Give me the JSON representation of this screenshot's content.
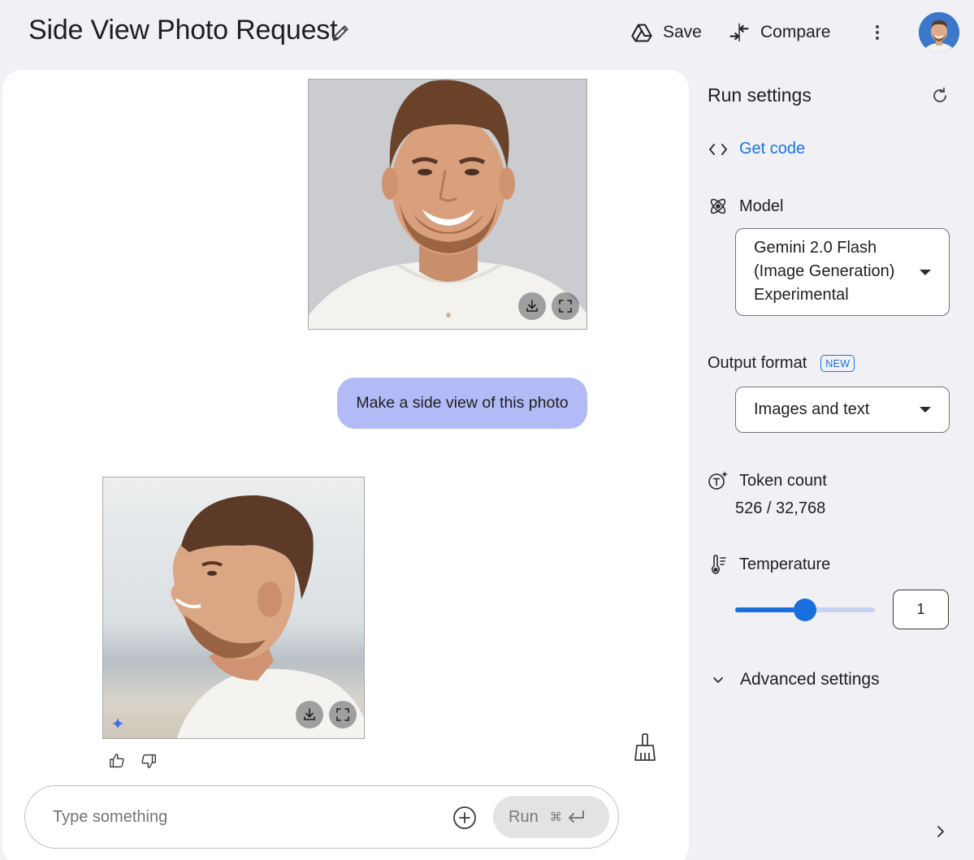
{
  "header": {
    "title": "Side View Photo Request",
    "save_label": "Save",
    "compare_label": "Compare"
  },
  "chat": {
    "user_message": "Make a side view of this photo",
    "input_placeholder": "Type something",
    "run_label": "Run",
    "run_shortcut": "⌘"
  },
  "settings": {
    "title": "Run settings",
    "get_code_label": "Get code",
    "model_label": "Model",
    "model_value_lines": [
      "Gemini 2.0 Flash",
      "(Image Generation)",
      "Experimental"
    ],
    "output_format_label": "Output format",
    "output_format_badge": "NEW",
    "output_format_value": "Images and text",
    "token_count_label": "Token count",
    "token_count_value": "526 / 32,768",
    "temperature_label": "Temperature",
    "temperature_value": "1",
    "temperature_fraction": 0.5,
    "advanced_label": "Advanced settings"
  },
  "colors": {
    "accent": "#1a73e8",
    "user_bubble": "#b3bbf6",
    "page_bg": "#f0f0f5"
  },
  "icons": [
    "edit-icon",
    "drive-icon",
    "compare-icon",
    "more-vert-icon",
    "refresh-icon",
    "code-icon",
    "model-icon",
    "token-icon",
    "thermometer-icon",
    "chevron-down-icon",
    "download-icon",
    "fullscreen-icon",
    "thumb-up-icon",
    "thumb-down-icon",
    "add-circle-icon",
    "broom-icon",
    "chevron-right-icon"
  ]
}
